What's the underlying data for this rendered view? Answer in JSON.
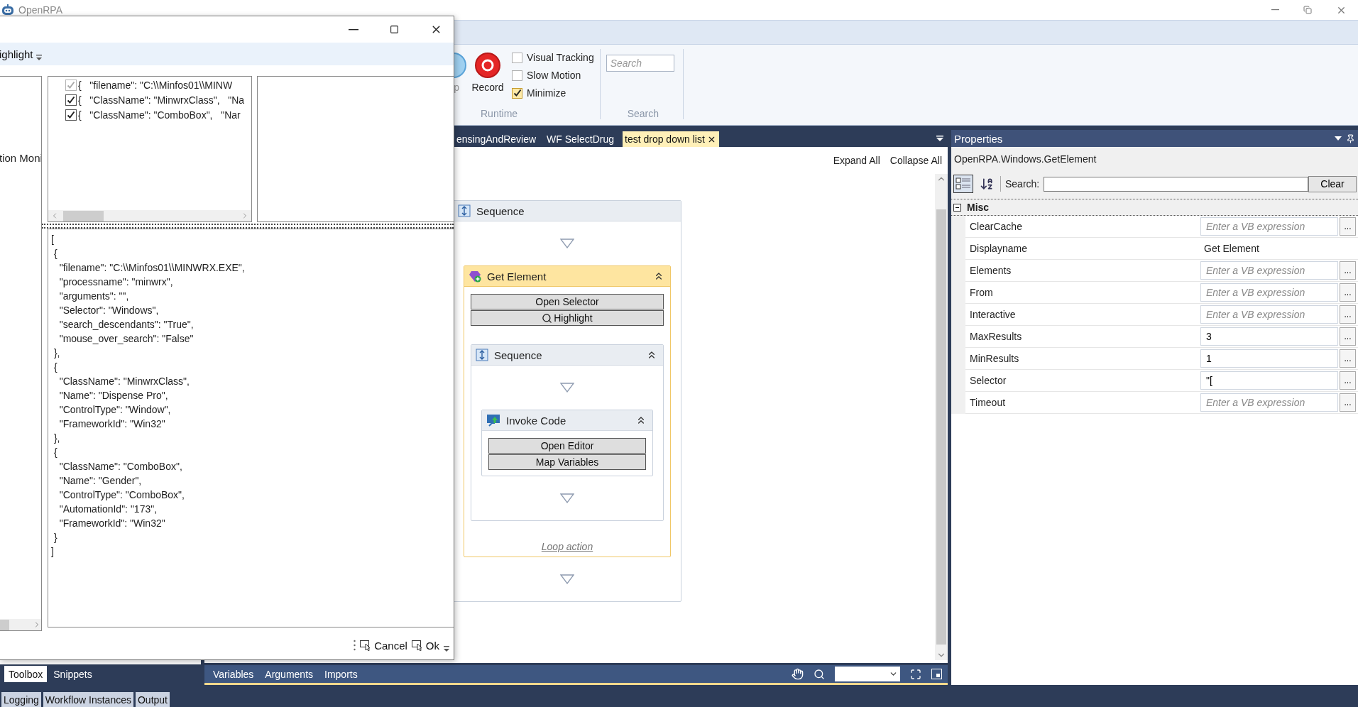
{
  "app": {
    "title": "OpenRPA"
  },
  "ribbon": {
    "partial_button": {
      "label": "p"
    },
    "record_button": {
      "label": "Record"
    },
    "options": [
      {
        "label": "Visual Tracking",
        "checked": false
      },
      {
        "label": "Slow Motion",
        "checked": false
      },
      {
        "label": "Minimize",
        "checked": true
      }
    ],
    "runtime_group": "Runtime",
    "search": {
      "placeholder": "Search"
    },
    "search_group": "Search"
  },
  "document_tabs": [
    {
      "label": "ensingAndReview",
      "selected": false
    },
    {
      "label": "WF SelectDrug",
      "selected": false
    },
    {
      "label": "test drop down list",
      "selected": true
    }
  ],
  "designer": {
    "expand_all": "Expand All",
    "collapse_all": "Collapse All",
    "root": {
      "kind": "sequence",
      "title": "Sequence",
      "selected": false,
      "children": [
        {
          "kind": "get_element",
          "title": "Get Element",
          "selected": true,
          "buttons": [
            {
              "label": "Open Selector"
            },
            {
              "label": "Highlight",
              "kind": "search"
            }
          ],
          "body": {
            "kind": "sequence",
            "title": "Sequence",
            "selected": false,
            "children": [
              {
                "kind": "invoke_code",
                "title": "Invoke Code",
                "selected": false,
                "buttons": [
                  {
                    "label": "Open Editor"
                  },
                  {
                    "label": "Map Variables"
                  }
                ]
              }
            ]
          },
          "footer": "Loop action"
        }
      ]
    },
    "footer_tabs": [
      "Variables",
      "Arguments",
      "Imports"
    ]
  },
  "properties": {
    "title": "Properties",
    "object": "OpenRPA.Windows.GetElement",
    "search_label": "Search:",
    "clear": "Clear",
    "category": "Misc",
    "rows": [
      {
        "name": "ClearCache",
        "kind": "expression",
        "placeholder": "Enter a VB expression",
        "button": "..."
      },
      {
        "name": "Displayname",
        "kind": "text",
        "value": "Get Element"
      },
      {
        "name": "Elements",
        "kind": "expression",
        "placeholder": "Enter a VB expression",
        "button": "..."
      },
      {
        "name": "From",
        "kind": "expression",
        "placeholder": "Enter a VB expression",
        "button": "..."
      },
      {
        "name": "Interactive",
        "kind": "expression",
        "placeholder": "Enter a VB expression",
        "button": "..."
      },
      {
        "name": "MaxResults",
        "kind": "expression",
        "value": "3",
        "button": "..."
      },
      {
        "name": "MinResults",
        "kind": "expression",
        "value": "1",
        "button": "..."
      },
      {
        "name": "Selector",
        "kind": "expression",
        "value": "\"[",
        "button": "..."
      },
      {
        "name": "Timeout",
        "kind": "expression",
        "placeholder": "Enter a VB expression",
        "button": "..."
      }
    ]
  },
  "toolbox_tabs": [
    {
      "label": "Toolbox",
      "selected": true
    },
    {
      "label": "Snippets",
      "selected": false
    }
  ],
  "output_tabs": [
    "Logging",
    "Workflow Instances",
    "Output"
  ],
  "dialog": {
    "toolbar_button": "ighlight",
    "left_pane_text": "tion Moni",
    "selectors": [
      {
        "text": "{   \"filename\": \"C:\\\\Minfos01\\\\MINW",
        "checked": true,
        "disabled": true
      },
      {
        "text": "{   \"ClassName\": \"MinwrxClass\",   \"Na",
        "checked": true,
        "disabled": false
      },
      {
        "text": "{   \"ClassName\": \"ComboBox\",   \"Nar",
        "checked": true,
        "disabled": false
      }
    ],
    "selector_json": "[\n {\n   \"filename\": \"C:\\\\Minfos01\\\\MINWRX.EXE\",\n   \"processname\": \"minwrx\",\n   \"arguments\": \"\",\n   \"Selector\": \"Windows\",\n   \"search_descendants\": \"True\",\n   \"mouse_over_search\": \"False\"\n },\n {\n   \"ClassName\": \"MinwrxClass\",\n   \"Name\": \"Dispense Pro\",\n   \"ControlType\": \"Window\",\n   \"FrameworkId\": \"Win32\"\n },\n {\n   \"ClassName\": \"ComboBox\",\n   \"Name\": \"Gender\",\n   \"ControlType\": \"ComboBox\",\n   \"AutomationId\": \"173\",\n   \"FrameworkId\": \"Win32\"\n }\n]",
    "cancel": "Cancel",
    "ok": "Ok"
  }
}
